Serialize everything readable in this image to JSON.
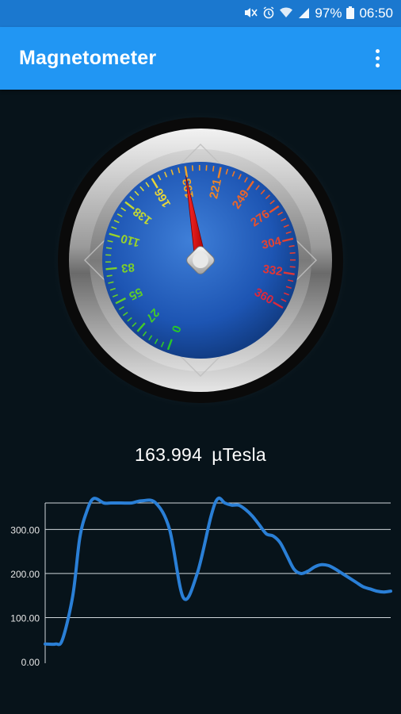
{
  "status_bar": {
    "battery": "97%",
    "time": "06:50",
    "icons": [
      "mute-icon",
      "alarm-icon",
      "wifi-icon",
      "signal-icon",
      "battery-icon"
    ]
  },
  "app_bar": {
    "title": "Magnetometer",
    "menu_icon": "overflow-menu-icon"
  },
  "gauge": {
    "tick_labels": [
      "0",
      "27",
      "55",
      "83",
      "110",
      "138",
      "166",
      "193",
      "221",
      "249",
      "276",
      "304",
      "332",
      "360"
    ],
    "min": 0,
    "max": 360,
    "needle_value": 193
  },
  "reading": {
    "value": "163.994",
    "unit": "µTesla"
  },
  "chart_data": {
    "type": "line",
    "ytick_labels": [
      "0.00",
      "100.00",
      "200.00",
      "300.00"
    ],
    "ylim": [
      0,
      360
    ],
    "grid": true,
    "series": [
      {
        "color": "#2a7fd6",
        "x": [
          0,
          3,
          5,
          8,
          10,
          12,
          14,
          17,
          19,
          22,
          25,
          28,
          32,
          36,
          40,
          44,
          48,
          50,
          52,
          54,
          56,
          58,
          60,
          62,
          64,
          66,
          68,
          70,
          72,
          74,
          76,
          78,
          80,
          82,
          84,
          86,
          88,
          90,
          92,
          94,
          96,
          98,
          100
        ],
        "values": [
          40,
          40,
          50,
          150,
          280,
          340,
          370,
          360,
          360,
          360,
          360,
          365,
          360,
          300,
          145,
          200,
          330,
          370,
          360,
          355,
          355,
          345,
          330,
          310,
          290,
          285,
          270,
          240,
          210,
          200,
          205,
          215,
          220,
          218,
          210,
          200,
          190,
          180,
          170,
          165,
          160,
          158,
          160
        ]
      }
    ]
  }
}
